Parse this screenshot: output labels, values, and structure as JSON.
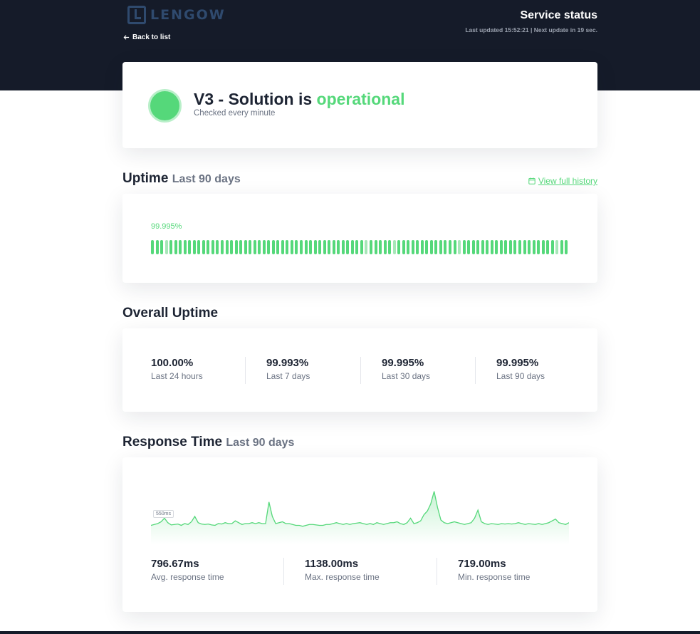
{
  "header": {
    "logo_text": "LENGOW",
    "back_label": "Back to list",
    "title": "Service status",
    "last_updated": "Last updated 15:52:21 | Next update in 19 sec."
  },
  "status": {
    "service_name": "V3 - Solution is",
    "state": "operational",
    "check_frequency": "Checked every minute",
    "color": "#55d87a"
  },
  "uptime": {
    "title": "Uptime",
    "period": "Last 90 days",
    "history_link": "View full history",
    "percentage": "99.995%",
    "days_total": 90,
    "partial_days": [
      3,
      46,
      52,
      66,
      87
    ]
  },
  "overall": {
    "title": "Overall Uptime",
    "stats": [
      {
        "value": "100.00%",
        "label": "Last 24 hours"
      },
      {
        "value": "99.993%",
        "label": "Last 7 days"
      },
      {
        "value": "99.995%",
        "label": "Last 30 days"
      },
      {
        "value": "99.995%",
        "label": "Last 90 days"
      }
    ]
  },
  "response": {
    "title": "Response Time",
    "period": "Last 90 days",
    "axis_tag": "550ms",
    "stats": [
      {
        "value": "796.67ms",
        "label": "Avg. response time"
      },
      {
        "value": "1138.00ms",
        "label": "Max. response time"
      },
      {
        "value": "719.00ms",
        "label": "Min. response time"
      }
    ]
  },
  "chart_data": {
    "type": "area",
    "ylim": [
      550,
      1200
    ],
    "values": [
      760,
      770,
      780,
      800,
      840,
      790,
      765,
      770,
      775,
      760,
      780,
      770,
      800,
      860,
      790,
      775,
      770,
      775,
      765,
      760,
      780,
      775,
      790,
      780,
      780,
      810,
      790,
      770,
      780,
      780,
      790,
      780,
      790,
      780,
      780,
      1020,
      860,
      780,
      790,
      800,
      780,
      780,
      770,
      760,
      760,
      750,
      760,
      770,
      770,
      765,
      760,
      760,
      770,
      770,
      780,
      790,
      780,
      770,
      780,
      770,
      780,
      785,
      790,
      780,
      770,
      780,
      770,
      790,
      780,
      770,
      780,
      790,
      790,
      800,
      780,
      770,
      790,
      840,
      780,
      790,
      810,
      880,
      920,
      1000,
      1138,
      960,
      820,
      790,
      780,
      790,
      800,
      790,
      780,
      770,
      780,
      790,
      840,
      930,
      800,
      780,
      770,
      780,
      775,
      770,
      780,
      775,
      780,
      775,
      780,
      790,
      780,
      770,
      780,
      775,
      770,
      780,
      770,
      780,
      790,
      810,
      830,
      790,
      780,
      770,
      790
    ]
  }
}
